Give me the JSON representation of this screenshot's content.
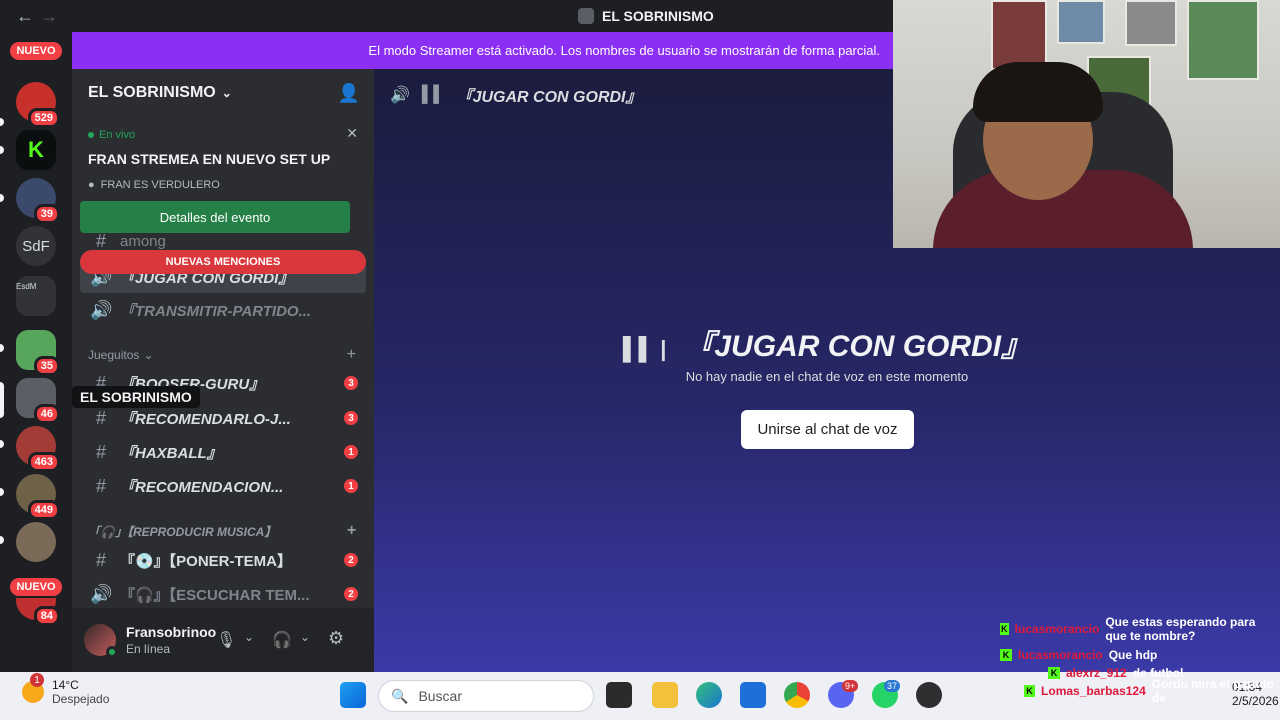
{
  "window": {
    "title": "EL SOBRINISMO"
  },
  "banner": {
    "text": "El modo Streamer está activado. Los nombres de usuario se mostrarán de forma parcial."
  },
  "server_rail": {
    "new_top": "NUEVO",
    "new_bottom": "NUEVO",
    "items": [
      {
        "count": "529",
        "color": "#c8312b"
      },
      {
        "count": "",
        "color": "#53fc18"
      },
      {
        "count": "39",
        "color": "#3b4a6b"
      },
      {
        "label": "SdF",
        "count": ""
      },
      {
        "label": "EsdM",
        "count": ""
      },
      {
        "count": "35",
        "color": "#58a55c"
      },
      {
        "count": "46",
        "color": "#5c5e66"
      },
      {
        "count": "463",
        "color": "#a33b36"
      },
      {
        "count": "449",
        "color": "#6d6248"
      },
      {
        "count": "",
        "color": "#7a6a58"
      },
      {
        "count": "84",
        "color": "#c02f2f"
      }
    ],
    "tooltip": "EL SOBRINISMO"
  },
  "sidebar": {
    "server_name": "EL SOBRINISMO",
    "event": {
      "status": "En vivo",
      "title": "FRAN STREMEA EN NUEVO SET UP",
      "location": "FRAN ES VERDULERO",
      "button": "Detalles del evento"
    },
    "mentions": "NUEVAS MENCIONES",
    "partial_channel": "among",
    "channels_top": [
      {
        "name": "『JUGAR CON GORDI』",
        "selected": true
      },
      {
        "name": "『TRANSMITIR-PARTIDO..."
      }
    ],
    "category1": "Jueguitos",
    "channels_cat1": [
      {
        "name": "『BOOSER-GURU』",
        "badge": "3"
      },
      {
        "name": "『RECOMENDARLO-J...",
        "badge": "3"
      },
      {
        "name": "『HAXBALL』",
        "badge": "1"
      },
      {
        "name": "『RECOMENDACION...",
        "badge": "1"
      }
    ],
    "category2": "「🎧」【REPRODUCIR MUSICA】",
    "channels_cat2": [
      {
        "name": "『💿』【PONER-TEMA】",
        "badge": "2"
      },
      {
        "name": "『🎧』【ESCUCHAR TEM...",
        "badge": "2"
      }
    ],
    "user": {
      "name": "Fransobrinoo",
      "status": "En línea"
    }
  },
  "main": {
    "header": "『JUGAR CON GORDI』",
    "title": "『JUGAR CON GORDI』",
    "subtitle": "No hay nadie en el chat de voz en este momento",
    "join_button": "Unirse al chat de voz"
  },
  "stream_chat": [
    {
      "user": "lucasmorancio",
      "msg": "Que estas esperando para que te nombre?"
    },
    {
      "user": "lucasmorancio",
      "msg": "Que hdp"
    },
    {
      "user": "alexrz_912",
      "msg": "de futbol"
    },
    {
      "user": "Lomas_barbas124",
      "msg": "Gordo mira el partido de"
    }
  ],
  "taskbar": {
    "weather_temp": "14°C",
    "weather_desc": "Despejado",
    "weather_badge": "1",
    "search_placeholder": "Buscar",
    "discord_badge": "9+",
    "whatsapp_badge": "37",
    "time": "01:34",
    "date": "2/5/2026"
  }
}
